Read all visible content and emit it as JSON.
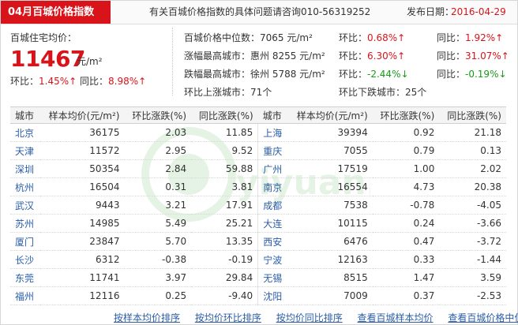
{
  "header": {
    "title": "04月百城价格指数",
    "hotline": "有关百城价格指数的具体问题请咨询010-56319252",
    "date_label": "发布日期：",
    "date": "2016-04-29"
  },
  "summary": {
    "avg_label": "百城住宅均价：",
    "avg_price": "11467",
    "avg_unit": "元/m²",
    "mom_label": "环比：",
    "mom_value": "1.45%↑",
    "yoy_label": "同比：",
    "yoy_value": "8.98%↑"
  },
  "stats": {
    "median_label": "百城价格中位数：",
    "median_value": "7065 元/m²",
    "median_mom_label": "环比：",
    "median_mom": "0.68%↑",
    "median_yoy_label": "同比：",
    "median_yoy": "1.92%↑",
    "top_rise_label": "涨幅最高城市：",
    "top_rise_value": "惠州 8255 元/m²",
    "top_rise_mom_label": "环比：",
    "top_rise_mom": "6.30%↑",
    "top_rise_yoy_label": "同比：",
    "top_rise_yoy": "31.07%↑",
    "top_fall_label": "跌幅最高城市：",
    "top_fall_value": "徐州 5788 元/m²",
    "top_fall_mom_label": "环比：",
    "top_fall_mom": "-2.44%↓",
    "top_fall_yoy_label": "同比：",
    "top_fall_yoy": "-0.19%↓",
    "up_cities": "环比上涨城市：71个",
    "down_cities": "环比下跌城市：25个"
  },
  "table": {
    "headers": [
      "城市",
      "样本均价(元/m²)",
      "环比涨跌(%)",
      "同比涨跌(%)",
      "城市",
      "样本均价(元/m²)",
      "环比涨跌(%)",
      "同比涨跌(%)"
    ],
    "rows": [
      [
        "北京",
        "36175",
        "2.03",
        "11.85",
        "上海",
        "39394",
        "0.92",
        "21.18"
      ],
      [
        "天津",
        "11572",
        "2.95",
        "9.52",
        "重庆",
        "7055",
        "0.79",
        "0.13"
      ],
      [
        "深圳",
        "50354",
        "2.84",
        "59.88",
        "广州",
        "17519",
        "1.00",
        "2.02"
      ],
      [
        "杭州",
        "16504",
        "0.31",
        "3.81",
        "南京",
        "16554",
        "4.73",
        "20.38"
      ],
      [
        "武汉",
        "9443",
        "3.21",
        "17.91",
        "成都",
        "7538",
        "-0.78",
        "-4.05"
      ],
      [
        "苏州",
        "14985",
        "5.49",
        "25.21",
        "大连",
        "10115",
        "0.24",
        "-3.66"
      ],
      [
        "厦门",
        "23847",
        "5.70",
        "13.35",
        "西安",
        "6476",
        "0.47",
        "-3.72"
      ],
      [
        "长沙",
        "6312",
        "-0.38",
        "-0.19",
        "宁波",
        "12163",
        "0.33",
        "-1.44"
      ],
      [
        "东莞",
        "11741",
        "3.97",
        "29.84",
        "无锡",
        "8515",
        "1.47",
        "3.59"
      ],
      [
        "福州",
        "12116",
        "0.25",
        "-9.40",
        "沈阳",
        "7009",
        "0.37",
        "-2.53"
      ]
    ]
  },
  "links": [
    "按样本均价排序",
    "按均价环比排序",
    "按均价同比排序",
    "查看百城样本均价",
    "查看百城价格中位数"
  ],
  "colors": {
    "accent": "#d9131a",
    "link": "#2a5ea8",
    "down": "#1a9a1a"
  },
  "watermark_text": "yiyuan.com"
}
